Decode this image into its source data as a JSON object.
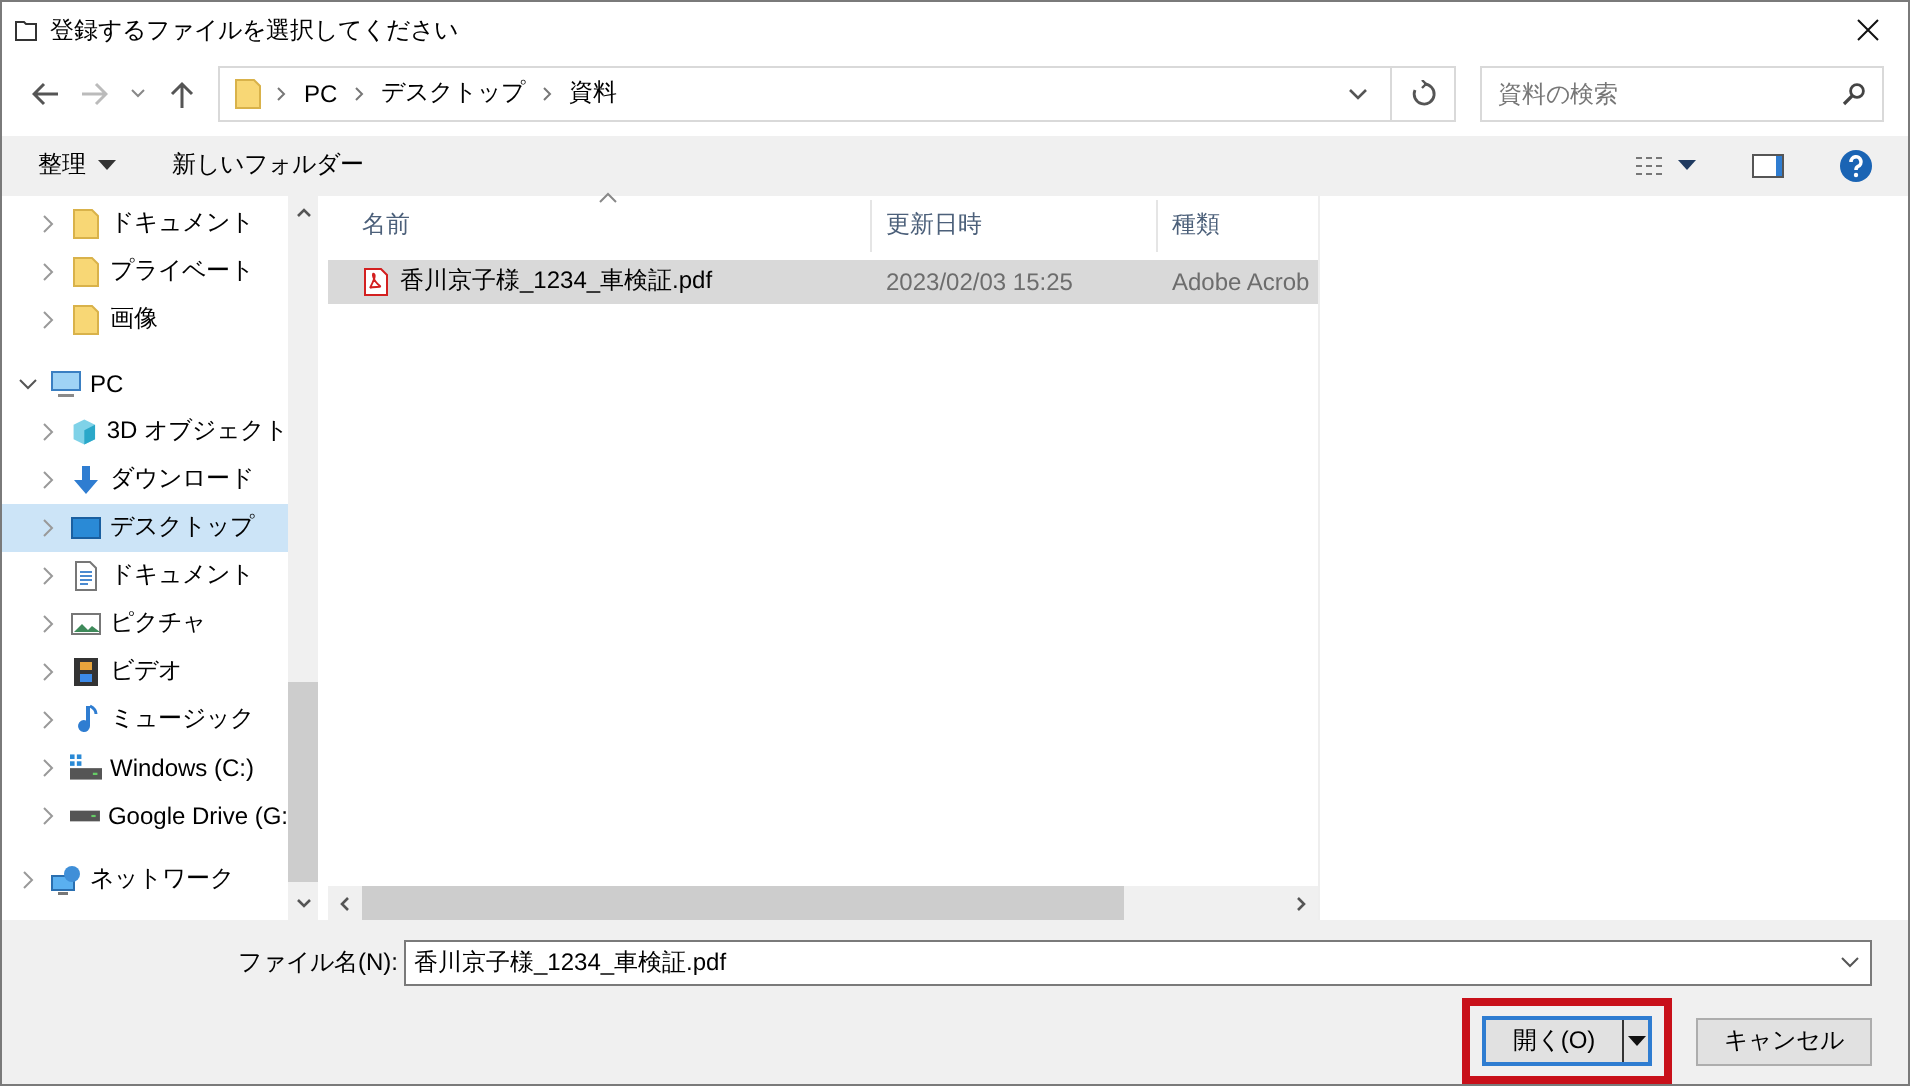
{
  "window": {
    "title": "登録するファイルを選択してください"
  },
  "address_bar": {
    "path": [
      "PC",
      "デスクトップ",
      "資料"
    ]
  },
  "search": {
    "placeholder": "資料の検索"
  },
  "toolbar": {
    "organize": "整理",
    "new_folder": "新しいフォルダー"
  },
  "sidebar": {
    "scrolled_children": [
      {
        "label": "ドキュメント",
        "kind": "folder",
        "selected": false,
        "expanded": false
      },
      {
        "label": "プライベート",
        "kind": "folder",
        "selected": false,
        "expanded": false
      },
      {
        "label": "画像",
        "kind": "folder",
        "selected": false,
        "expanded": false
      }
    ],
    "items": [
      {
        "label": "PC",
        "kind": "pc",
        "selected": false,
        "expanded": true,
        "children": [
          {
            "label": "3D オブジェクト",
            "kind": "cube",
            "selected": false,
            "expanded": false
          },
          {
            "label": "ダウンロード",
            "kind": "download",
            "selected": false,
            "expanded": false
          },
          {
            "label": "デスクトップ",
            "kind": "desktop",
            "selected": true,
            "expanded": false
          },
          {
            "label": "ドキュメント",
            "kind": "document",
            "selected": false,
            "expanded": false
          },
          {
            "label": "ピクチャ",
            "kind": "pictures",
            "selected": false,
            "expanded": false
          },
          {
            "label": "ビデオ",
            "kind": "video",
            "selected": false,
            "expanded": false
          },
          {
            "label": "ミュージック",
            "kind": "music",
            "selected": false,
            "expanded": false
          },
          {
            "label": "Windows (C:)",
            "kind": "system_drive",
            "selected": false,
            "expanded": false
          },
          {
            "label": "Google Drive (G:",
            "kind": "drive",
            "selected": false,
            "expanded": false
          }
        ]
      },
      {
        "label": "ネットワーク",
        "kind": "network",
        "selected": false,
        "expanded": false
      }
    ]
  },
  "file_list": {
    "columns": [
      "名前",
      "更新日時",
      "種類"
    ],
    "rows": [
      {
        "name": "香川京子様_1234_車検証.pdf",
        "modified": "2023/02/03 15:25",
        "type": "Adobe Acrob",
        "selected": true
      }
    ]
  },
  "file_name": {
    "label": "ファイル名(N):",
    "value": "香川京子様_1234_車検証.pdf"
  },
  "buttons": {
    "open": "開く(O)",
    "cancel": "キャンセル"
  }
}
